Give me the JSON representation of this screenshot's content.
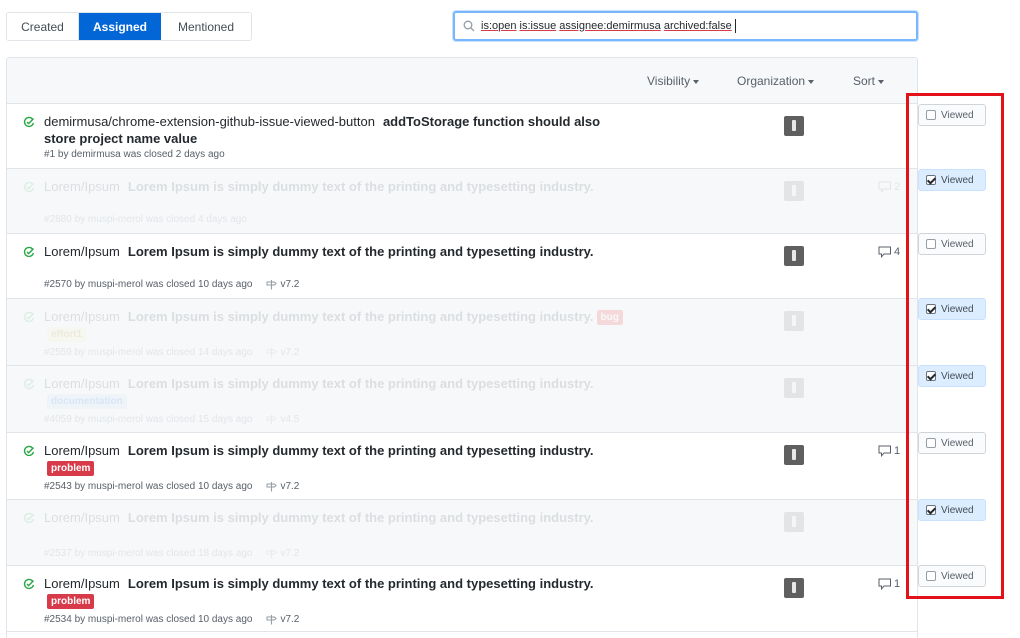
{
  "tabs": [
    {
      "label": "Created",
      "active": false
    },
    {
      "label": "Assigned",
      "active": true
    },
    {
      "label": "Mentioned",
      "active": false
    }
  ],
  "search": {
    "tokens": [
      "is:open",
      "is:issue",
      "assignee:demirmusa",
      "archived:false"
    ],
    "icon": "search-icon"
  },
  "filters": {
    "visibility": "Visibility",
    "organization": "Organization",
    "sort": "Sort"
  },
  "viewed_label": "Viewed",
  "colors": {
    "accent": "#0366d6",
    "closed_icon": "#28a745",
    "highlight_border": "#e3111a",
    "viewed_on_bg": "#dbedff"
  },
  "issues": [
    {
      "repo": "demirmusa/chrome-extension-github-issue-viewed-button",
      "title": "addToStorage function should also store project name value",
      "labels": [],
      "meta": "#1 by demirmusa was closed 2 days ago",
      "milestone": "",
      "comments": "",
      "viewed": false,
      "faded": false
    },
    {
      "repo": "Lorem/Ipsum",
      "title": "Lorem Ipsum is simply dummy text of the printing and typesetting industry.",
      "labels": [],
      "meta": "#2880 by muspi-merol was closed 4 days ago",
      "milestone": "",
      "comments": "2",
      "viewed": true,
      "faded": true
    },
    {
      "repo": "Lorem/Ipsum",
      "title": "Lorem Ipsum is simply dummy text of the printing and typesetting industry.",
      "labels": [],
      "meta": "#2570 by muspi-merol was closed 10 days ago",
      "milestone": "v7.2",
      "comments": "4",
      "viewed": false,
      "faded": false
    },
    {
      "repo": "Lorem/Ipsum",
      "title": "Lorem Ipsum is simply dummy text of the printing and typesetting industry.",
      "labels": [
        {
          "text": "bug",
          "kind": "bug"
        },
        {
          "text": "effort1",
          "kind": "effort"
        }
      ],
      "meta": "#2559 by muspi-merol was closed 14 days ago",
      "milestone": "v7.2",
      "comments": "",
      "viewed": true,
      "faded": true
    },
    {
      "repo": "Lorem/Ipsum",
      "title": "Lorem Ipsum is simply dummy text of the printing and typesetting industry.",
      "labels": [
        {
          "text": "documentation",
          "kind": "doc"
        }
      ],
      "meta": "#4059 by muspi-merol was closed 15 days ago",
      "milestone": "v4.5",
      "comments": "",
      "viewed": true,
      "faded": true
    },
    {
      "repo": "Lorem/Ipsum",
      "title": "Lorem Ipsum is simply dummy text of the printing and typesetting industry.",
      "labels": [
        {
          "text": "problem",
          "kind": "problem"
        }
      ],
      "meta": "#2543 by muspi-merol was closed 10 days ago",
      "milestone": "v7.2",
      "comments": "1",
      "viewed": false,
      "faded": false
    },
    {
      "repo": "Lorem/Ipsum",
      "title": "Lorem Ipsum is simply dummy text of the printing and typesetting industry.",
      "labels": [],
      "meta": "#2537 by muspi-merol was closed 18 days ago",
      "milestone": "v7.2",
      "comments": "",
      "viewed": true,
      "faded": true
    },
    {
      "repo": "Lorem/Ipsum",
      "title": "Lorem Ipsum is simply dummy text of the printing and typesetting industry.",
      "labels": [
        {
          "text": "problem",
          "kind": "problem"
        }
      ],
      "meta": "#2534 by muspi-merol was closed 10 days ago",
      "milestone": "v7.2",
      "comments": "1",
      "viewed": false,
      "faded": false
    }
  ]
}
